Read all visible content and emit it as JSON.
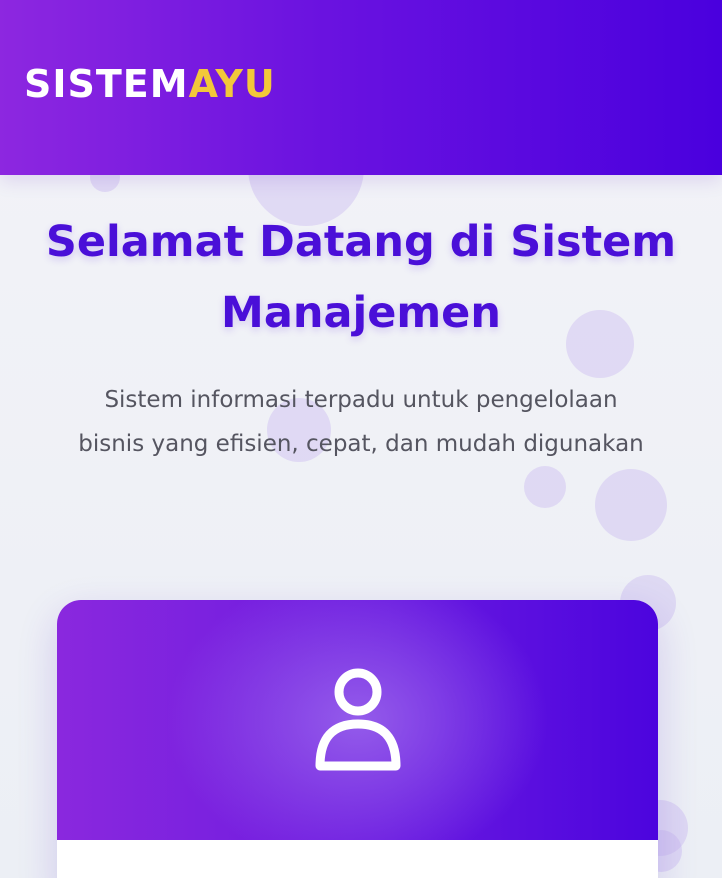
{
  "header": {
    "logo_main": "SISTEM",
    "logo_accent": "AYU"
  },
  "hero": {
    "title_line1": "Selamat Datang di Sistem",
    "title_line2": "Manajemen",
    "subtitle_line1": "Sistem informasi terpadu untuk pengelolaan",
    "subtitle_line2": "bisnis yang efisien, cepat, dan mudah digunakan"
  },
  "card": {
    "icon": "user-icon"
  },
  "colors": {
    "header_gradient_start": "#8d27e0",
    "header_gradient_end": "#4a00de",
    "logo_accent": "#f2c83a",
    "title": "#4a0fd8",
    "subtitle": "#555560",
    "background": "#f0f1f6"
  }
}
